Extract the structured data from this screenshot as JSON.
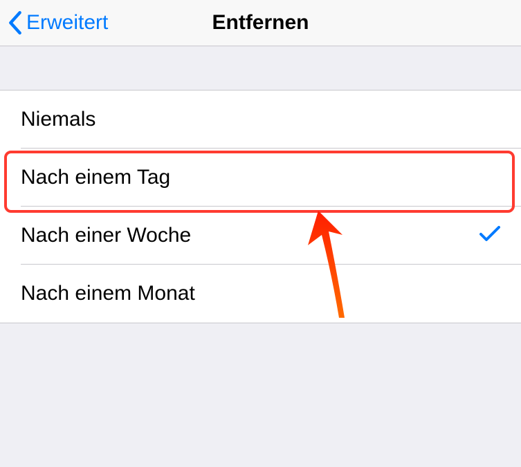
{
  "nav": {
    "back_label": "Erweitert",
    "title": "Entfernen"
  },
  "options": [
    {
      "label": "Niemals",
      "selected": false
    },
    {
      "label": "Nach einem Tag",
      "selected": false
    },
    {
      "label": "Nach einer Woche",
      "selected": true
    },
    {
      "label": "Nach einem Monat",
      "selected": false
    }
  ],
  "annotation": {
    "highlight_index": 1
  }
}
